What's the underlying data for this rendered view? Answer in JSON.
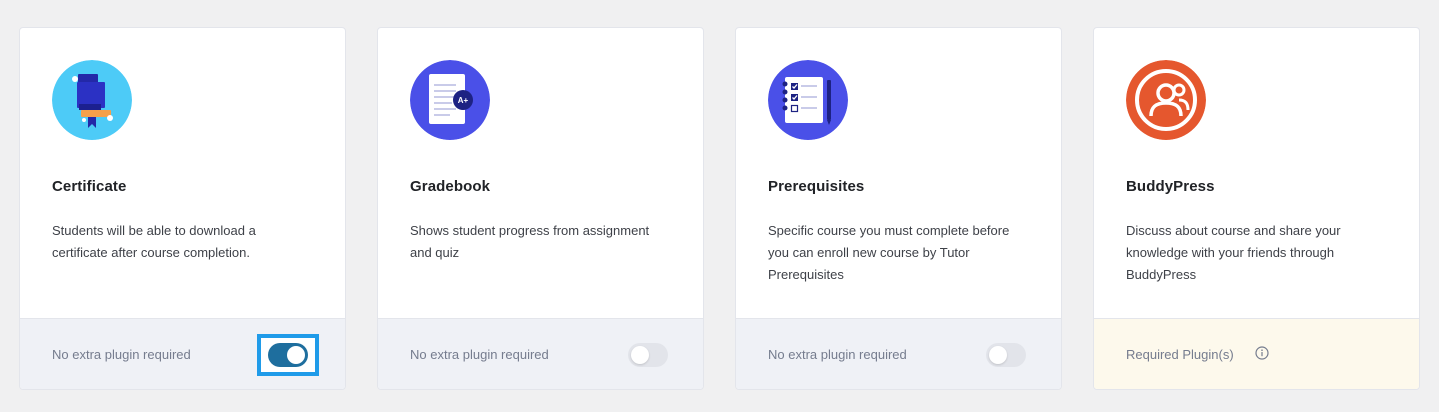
{
  "addons": [
    {
      "title": "Certificate",
      "description": "Students will be able to download a certificate after course completion.",
      "footer_label": "No extra plugin required",
      "enabled": true,
      "icon": "certificate-icon",
      "icon_bg": "#4dcbf7"
    },
    {
      "title": "Gradebook",
      "description": "Shows student progress from assignment and quiz",
      "footer_label": "No extra plugin required",
      "enabled": false,
      "icon": "gradebook-icon",
      "icon_bg": "#4a50e8",
      "badge_text": "A+"
    },
    {
      "title": "Prerequisites",
      "description": "Specific course you must complete before you can enroll new course by Tutor Prerequisites",
      "footer_label": "No extra plugin required",
      "enabled": false,
      "icon": "prerequisites-icon",
      "icon_bg": "#4a50e8"
    },
    {
      "title": "BuddyPress",
      "description": "Discuss about course and share your knowledge with your friends through BuddyPress",
      "footer_label": "Required Plugin(s)",
      "enabled": false,
      "icon": "buddypress-icon",
      "icon_bg": "#e5572e",
      "footer_icon": "info-icon"
    }
  ],
  "colors": {
    "page_bg": "#f0f0f1",
    "toggle_on": "#1e6e9e",
    "toggle_off": "#e2e4ea",
    "focus_ring": "#1f9be9",
    "warning_footer": "#fdf9ec"
  }
}
